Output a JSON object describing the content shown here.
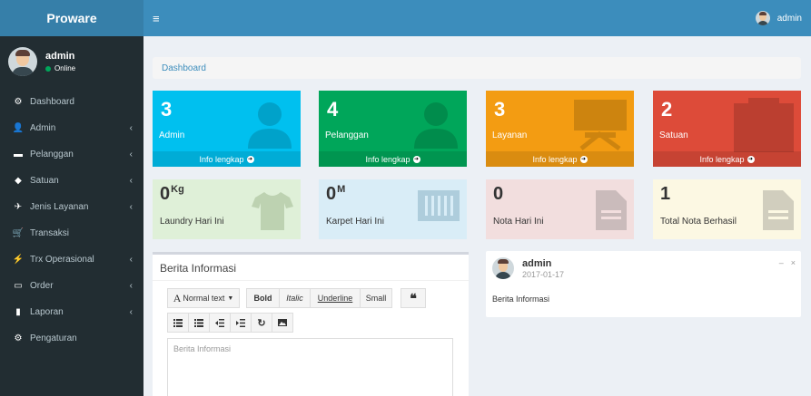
{
  "brand": "Proware",
  "user": {
    "name": "admin",
    "status": "Online"
  },
  "sidebar": {
    "items": [
      {
        "icon": "dashboard-icon",
        "glyph": "⚙",
        "label": "Dashboard",
        "chev": ""
      },
      {
        "icon": "user-icon",
        "glyph": "👤",
        "label": "Admin",
        "chev": "‹"
      },
      {
        "icon": "folder-icon",
        "glyph": "▬",
        "label": "Pelanggan",
        "chev": "‹"
      },
      {
        "icon": "tag-icon",
        "glyph": "◆",
        "label": "Satuan",
        "chev": "‹"
      },
      {
        "icon": "plane-icon",
        "glyph": "✈",
        "label": "Jenis Layanan",
        "chev": "‹"
      },
      {
        "icon": "cart-icon",
        "glyph": "🛒",
        "label": "Transaksi",
        "chev": ""
      },
      {
        "icon": "bolt-icon",
        "glyph": "⚡",
        "label": "Trx Operasional",
        "chev": "‹"
      },
      {
        "icon": "monitor-icon",
        "glyph": "▭",
        "label": "Order",
        "chev": "‹"
      },
      {
        "icon": "bar-chart-icon",
        "glyph": "▮",
        "label": "Laporan",
        "chev": "‹"
      },
      {
        "icon": "gear-icon",
        "glyph": "⚙",
        "label": "Pengaturan",
        "chev": ""
      }
    ]
  },
  "header": {
    "toggle_glyph": "≡",
    "user": "admin"
  },
  "breadcrumb": "Dashboard",
  "boxes": [
    {
      "num": "3",
      "label": "Admin",
      "footer": "Info lengkap",
      "color": "#00c0ef"
    },
    {
      "num": "4",
      "label": "Pelanggan",
      "footer": "Info lengkap",
      "color": "#00a65a"
    },
    {
      "num": "3",
      "label": "Layanan",
      "footer": "Info lengkap",
      "color": "#f39c12"
    },
    {
      "num": "2",
      "label": "Satuan",
      "footer": "Info lengkap",
      "color": "#dd4b39"
    }
  ],
  "infos": [
    {
      "num": "0",
      "unit": "Kg",
      "label": "Laundry Hari Ini",
      "bg": "#dff0d8"
    },
    {
      "num": "0",
      "unit": "M",
      "label": "Karpet Hari Ini",
      "bg": "#d9edf7"
    },
    {
      "num": "0",
      "unit": "",
      "label": "Nota Hari Ini",
      "bg": "#f2dede"
    },
    {
      "num": "1",
      "unit": "",
      "label": "Total Nota Berhasil",
      "bg": "#fcf8e3"
    }
  ],
  "berita": {
    "title": "Berita Informasi",
    "toolbar": {
      "style": "Normal text",
      "bold": "Bold",
      "italic": "Italic",
      "underline": "Underline",
      "small": "Small",
      "quote": "❝"
    },
    "placeholder": "Berita Informasi"
  },
  "post": {
    "name": "admin",
    "date": "2017-01-17",
    "body": "Berita Informasi",
    "minimize": "–",
    "close": "×"
  }
}
